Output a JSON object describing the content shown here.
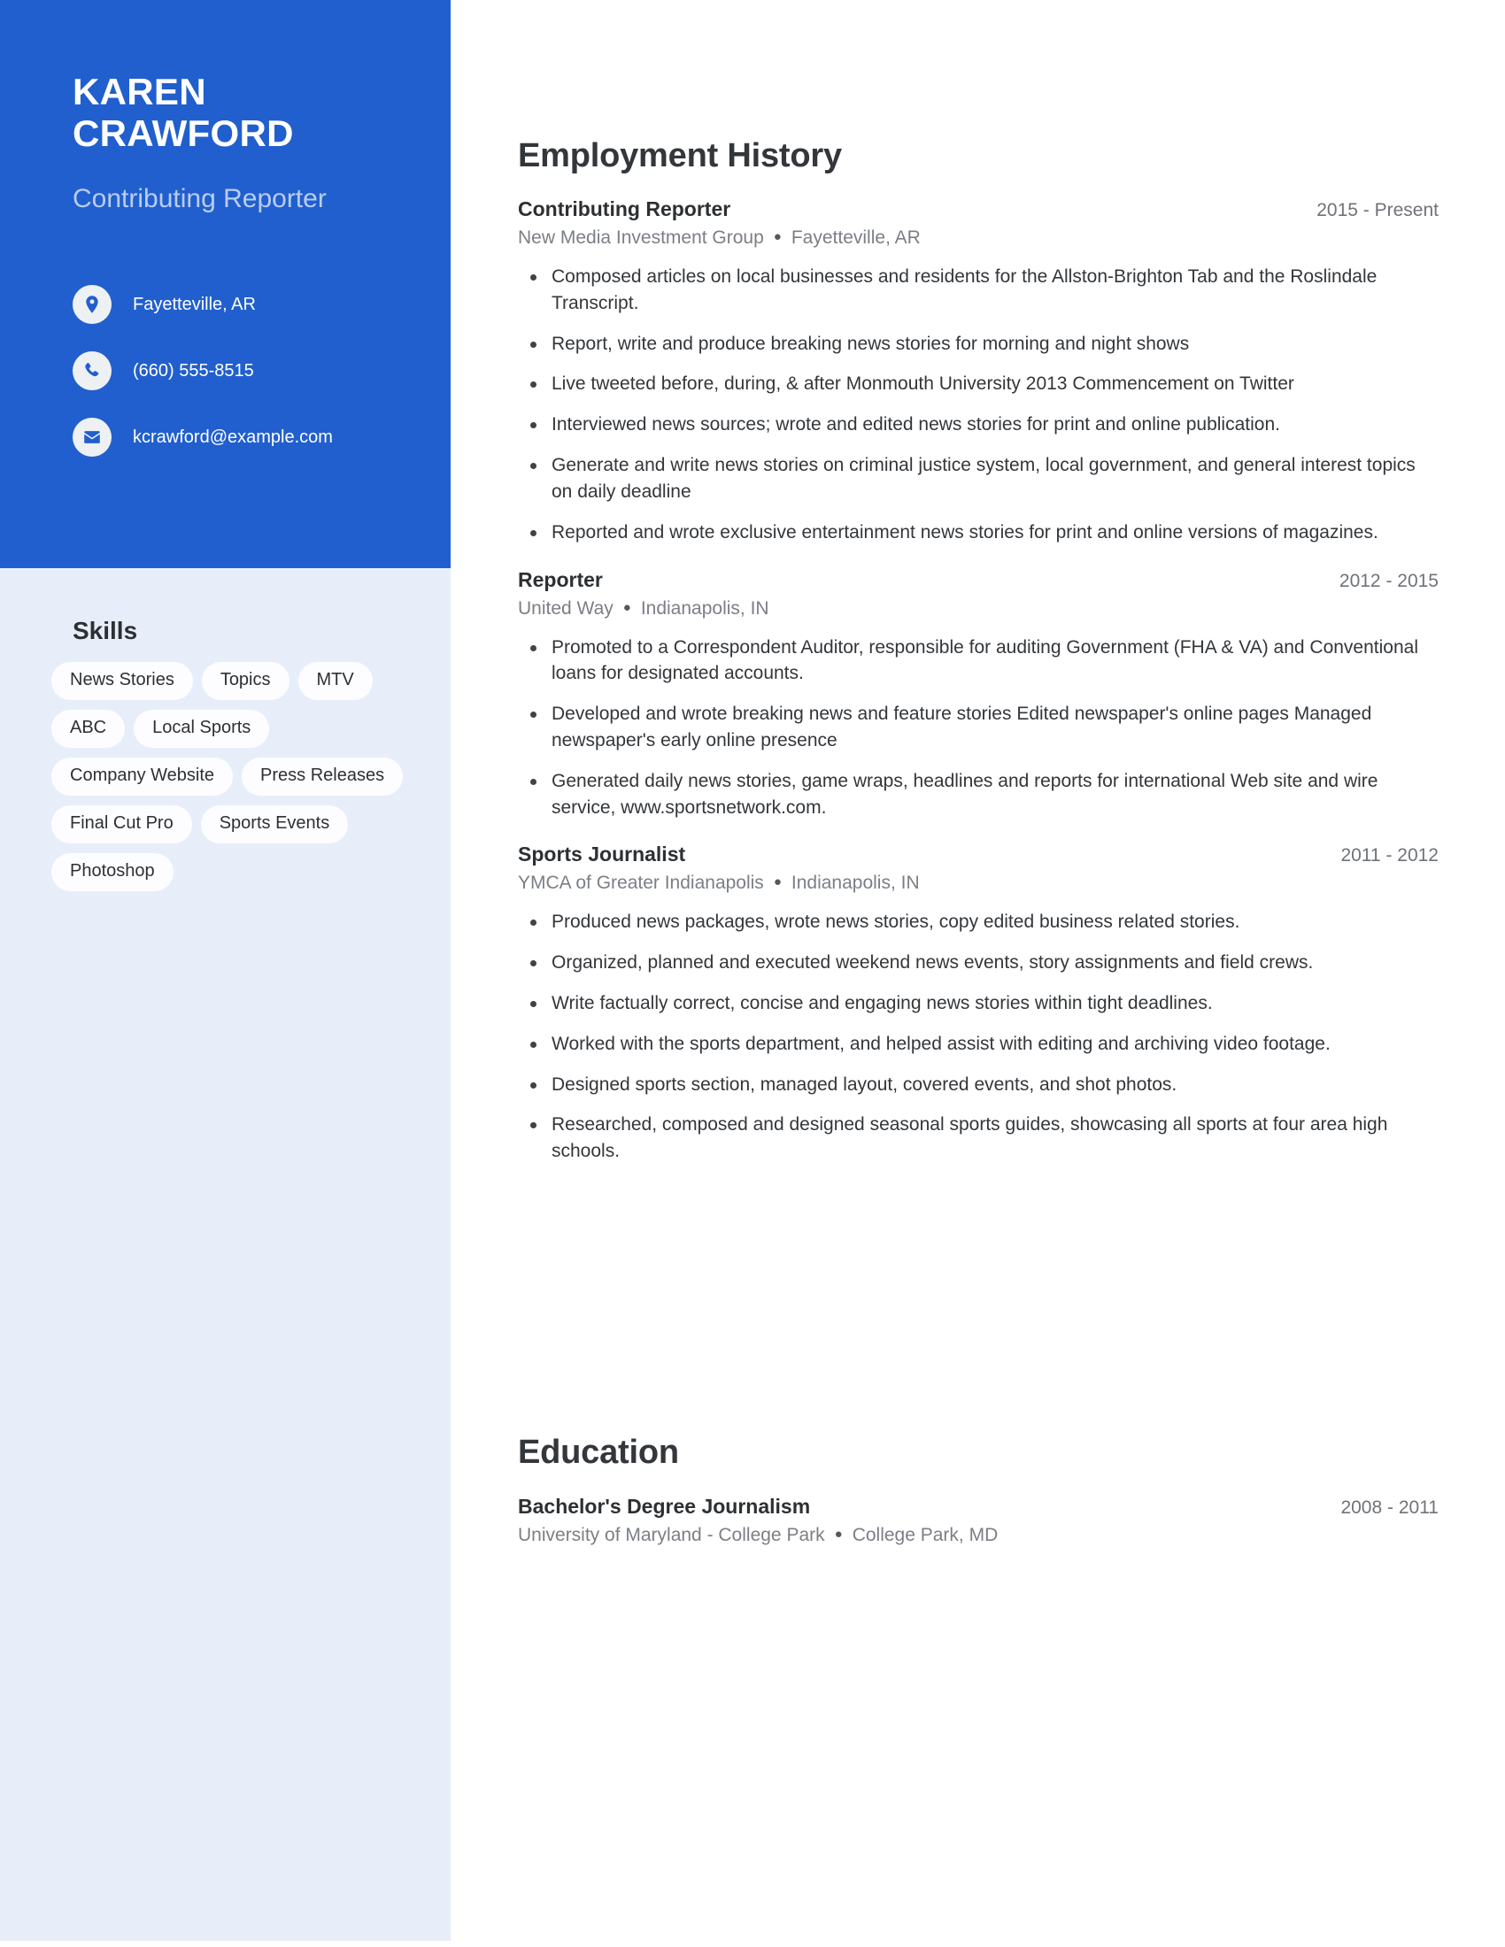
{
  "theme": {
    "accent_blue": "#215fce",
    "sidebar_blue": "#e8eef9",
    "pill_white": "#fdfdff",
    "text_dark": "#33363a",
    "text_muted": "#7b7f85",
    "title_light": "#b9cdef"
  },
  "profile": {
    "first_name": "KAREN",
    "last_name": "CRAWFORD",
    "headline": "Contributing Reporter"
  },
  "contacts": [
    {
      "icon": "location-pin-icon",
      "value": "Fayetteville, AR"
    },
    {
      "icon": "phone-icon",
      "value": "(660) 555-8515"
    },
    {
      "icon": "email-icon",
      "value": "kcrawford@example.com"
    }
  ],
  "skills": {
    "heading": "Skills",
    "items": [
      "News Stories",
      "Topics",
      "MTV",
      "ABC",
      "Local Sports",
      "Company Website",
      "Press Releases",
      "Final Cut Pro",
      "Sports Events",
      "Photoshop"
    ]
  },
  "employment": {
    "heading": "Employment History",
    "entries": [
      {
        "role": "Contributing Reporter",
        "dates": "2015 - Present",
        "company": "New Media Investment Group",
        "location": "Fayetteville, AR",
        "bullets": [
          "Composed articles on local businesses and residents for the Allston-Brighton Tab and the Roslindale Transcript.",
          "Report, write and produce breaking news stories for morning and night shows",
          "Live tweeted before, during, & after Monmouth University 2013 Commencement on Twitter",
          "Interviewed news sources; wrote and edited news stories for print and online publication.",
          "Generate and write news stories on criminal justice system, local government, and general interest topics on daily deadline",
          "Reported and wrote exclusive entertainment news stories for print and online versions of magazines."
        ]
      },
      {
        "role": "Reporter",
        "dates": "2012 - 2015",
        "company": "United Way",
        "location": "Indianapolis, IN",
        "bullets": [
          "Promoted to a Correspondent Auditor, responsible for auditing Government (FHA & VA) and Conventional loans for designated accounts.",
          "Developed and wrote breaking news and feature stories Edited newspaper's online pages Managed newspaper's early online presence",
          "Generated daily news stories, game wraps, headlines and reports for international Web site and wire service, www.sportsnetwork.com."
        ]
      },
      {
        "role": "Sports Journalist",
        "dates": "2011 - 2012",
        "company": "YMCA of Greater Indianapolis",
        "location": "Indianapolis, IN",
        "bullets": [
          "Produced news packages, wrote news stories, copy edited business related stories.",
          "Organized, planned and executed weekend news events, story assignments and field crews.",
          "Write factually correct, concise and engaging news stories within tight deadlines.",
          "Worked with the sports department, and helped assist with editing and archiving video footage.",
          "Designed sports section, managed layout, covered events, and shot photos.",
          "Researched, composed and designed seasonal sports guides, showcasing all sports at four area high schools."
        ]
      }
    ]
  },
  "education": {
    "heading": "Education",
    "entries": [
      {
        "degree": "Bachelor's Degree Journalism",
        "dates": "2008 - 2011",
        "school": "University of Maryland - College Park",
        "location": "College Park, MD"
      }
    ]
  },
  "separator": "●"
}
